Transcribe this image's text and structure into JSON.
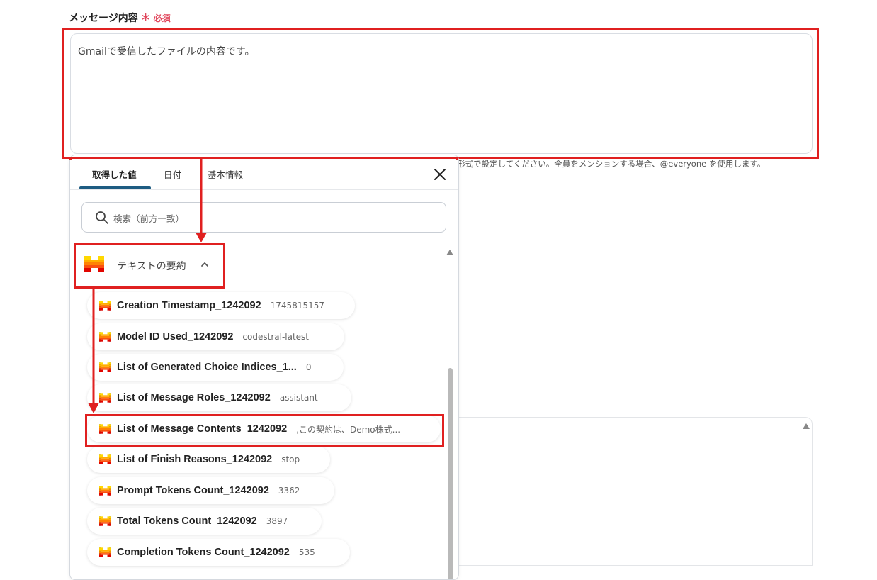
{
  "form": {
    "label": "メッセージ内容",
    "required_mark": "＊",
    "required_text": "必須",
    "message_value": "Gmailで受信したファイルの内容です。",
    "hint": "形式で設定してください。全員をメンションする場合、@everyone を使用します。"
  },
  "panel": {
    "tabs": [
      {
        "label": "取得した値",
        "active": true
      },
      {
        "label": "日付",
        "active": false
      },
      {
        "label": "基本情報",
        "active": false
      }
    ],
    "search_placeholder": "検索（前方一致）",
    "group_title": "テキストの要約",
    "items": [
      {
        "label": "Creation Timestamp_1242092",
        "value": "1745815157"
      },
      {
        "label": "Model ID Used_1242092",
        "value": "codestral-latest"
      },
      {
        "label": "List of Generated Choice Indices_1...",
        "value": "0"
      },
      {
        "label": "List of Message Roles_1242092",
        "value": "assistant"
      },
      {
        "label": "List of Message Contents_1242092",
        "value": ",この契約は、Demo株式..."
      },
      {
        "label": "List of Finish Reasons_1242092",
        "value": "stop"
      },
      {
        "label": "Prompt Tokens Count_1242092",
        "value": "3362"
      },
      {
        "label": "Total Tokens Count_1242092",
        "value": "3897"
      },
      {
        "label": "Completion Tokens Count_1242092",
        "value": "535"
      }
    ]
  },
  "colors": {
    "highlight": "#e02020",
    "tab_accent": "#1d5c82",
    "required": "#e0455b"
  },
  "icons": [
    "search-icon",
    "close-icon",
    "chevron-up-icon",
    "mistral-logo-icon"
  ]
}
